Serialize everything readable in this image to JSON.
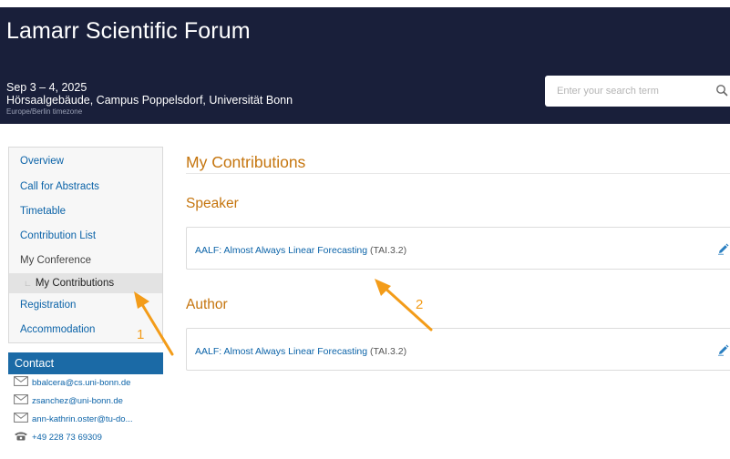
{
  "header": {
    "title": "Lamarr Scientific Forum",
    "dates": "Sep 3 – 4, 2025",
    "venue": "Hörsaalgebäude, Campus Poppelsdorf, Universität Bonn",
    "timezone": "Europe/Berlin timezone",
    "search_placeholder": "Enter your search term",
    "search_icon": "magnifier-icon"
  },
  "sidebar": {
    "items": [
      {
        "label": "Overview"
      },
      {
        "label": "Call for Abstracts"
      },
      {
        "label": "Timetable"
      },
      {
        "label": "Contribution List"
      },
      {
        "label": "My Conference"
      },
      {
        "label": "My Contributions",
        "sub_marker": "∟"
      },
      {
        "label": "Registration"
      },
      {
        "label": "Accommodation"
      }
    ]
  },
  "contact": {
    "title": "Contact",
    "emails": [
      "bbalcera@cs.uni-bonn.de",
      "zsanchez@uni-bonn.de",
      "ann-kathrin.oster@tu-do..."
    ],
    "phone": "+49 228 73 69309"
  },
  "main": {
    "title": "My Contributions",
    "sections": [
      {
        "heading": "Speaker",
        "contribution": {
          "title": "AALF: Almost Always Linear Forecasting",
          "code": "(TAI.3.2)"
        }
      },
      {
        "heading": "Author",
        "contribution": {
          "title": "AALF: Almost Always Linear Forecasting",
          "code": "(TAI.3.2)"
        }
      }
    ]
  },
  "annotations": [
    {
      "label": "1",
      "color": "#f39c19"
    },
    {
      "label": "2",
      "color": "#f39c19"
    }
  ],
  "colors": {
    "header_bg": "#191f3a",
    "link": "#0b63a8",
    "accent_orange": "#c5750e",
    "contact_header": "#1b6aa6",
    "annotation": "#f39c19"
  }
}
